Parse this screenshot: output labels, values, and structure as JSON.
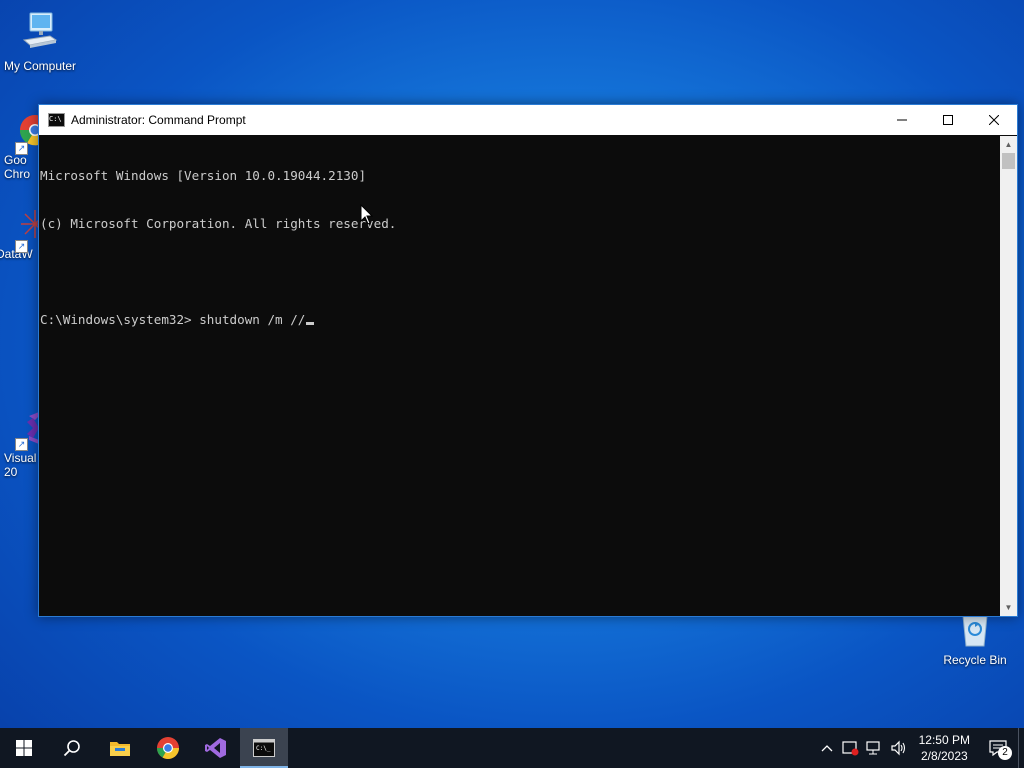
{
  "desktop": {
    "icons": [
      {
        "label": "My Computer"
      },
      {
        "label": "Goo\nChro"
      },
      {
        "label": "DataW"
      },
      {
        "label": "Visual\n20"
      },
      {
        "label": "Recycle Bin"
      }
    ]
  },
  "window": {
    "title": "Administrator:  Command Prompt",
    "buttons": {
      "minimize": "—",
      "maximize": "☐",
      "close": "✕"
    }
  },
  "console": {
    "lines": [
      "Microsoft Windows [Version 10.0.19044.2130]",
      "(c) Microsoft Corporation. All rights reserved.",
      "",
      "C:\\Windows\\system32> shutdown /m //"
    ]
  },
  "taskbar": {
    "items": [
      "start-icon",
      "search-icon",
      "file-explorer-icon",
      "chrome-icon",
      "visual-studio-icon",
      "command-prompt-icon"
    ],
    "time": "12:50 PM",
    "date": "2/8/2023",
    "notification_count": "2"
  },
  "colors": {
    "desktop": "#0a55c4",
    "console_bg": "#0c0c0c",
    "console_fg": "#cccccc",
    "taskbar": "#101722"
  }
}
